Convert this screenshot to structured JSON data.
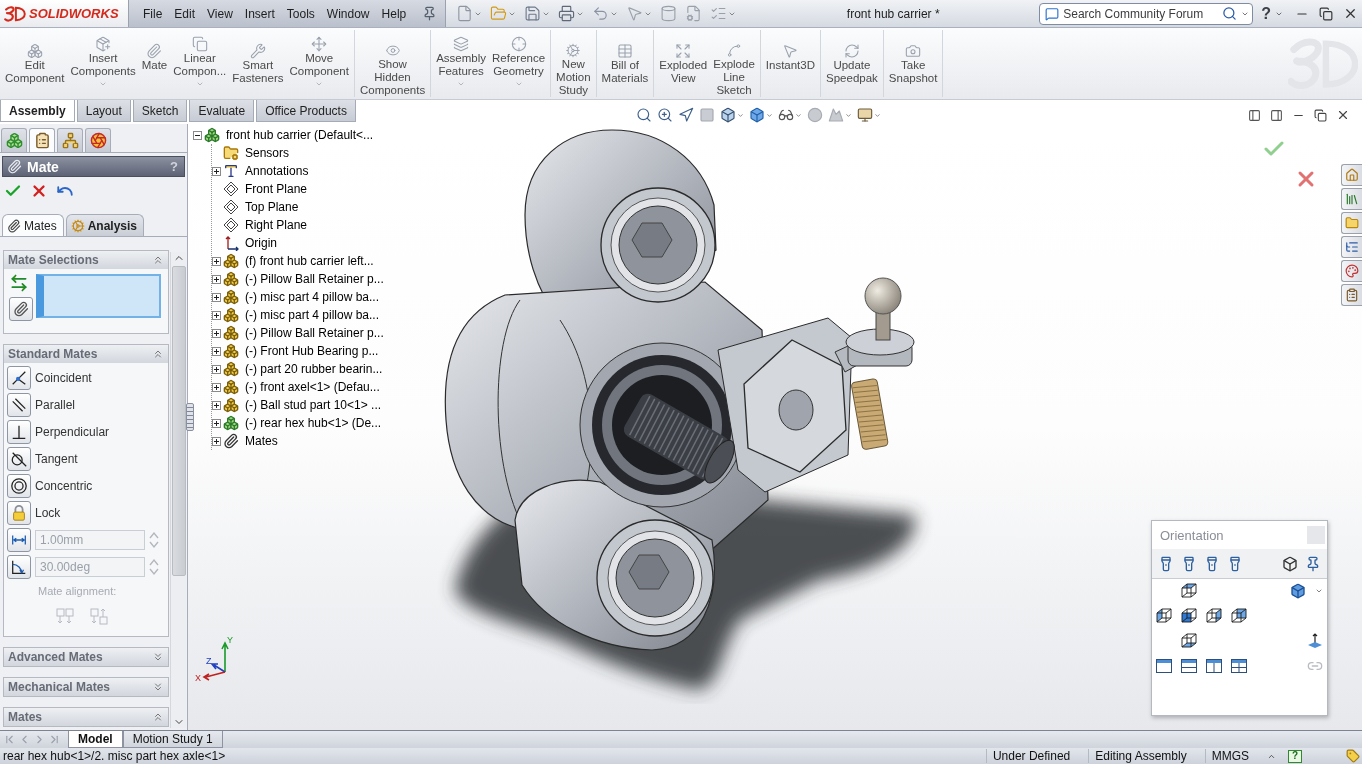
{
  "title_bar": {
    "logo": "SOLIDWORKS",
    "menu": [
      "File",
      "Edit",
      "View",
      "Insert",
      "Tools",
      "Window",
      "Help"
    ],
    "document_title": "front hub carrier *",
    "search": {
      "placeholder": "Search Community Forum"
    },
    "help": "?"
  },
  "command_manager": {
    "groups": [
      [
        {
          "label": "Edit\nComponent",
          "dropdown": false
        },
        {
          "label": "Insert\nComponents",
          "dropdown": true
        },
        {
          "label": "Mate",
          "dropdown": false
        },
        {
          "label": "Linear\nCompon...",
          "dropdown": true
        },
        {
          "label": "Smart\nFasteners",
          "dropdown": false
        },
        {
          "label": "Move\nComponent",
          "dropdown": true
        }
      ],
      [
        {
          "label": "Show\nHidden\nComponents",
          "dropdown": false
        }
      ],
      [
        {
          "label": "Assembly\nFeatures",
          "dropdown": true
        },
        {
          "label": "Reference\nGeometry",
          "dropdown": true
        }
      ],
      [
        {
          "label": "New\nMotion\nStudy",
          "dropdown": false
        }
      ],
      [
        {
          "label": "Bill of\nMaterials",
          "dropdown": false
        }
      ],
      [
        {
          "label": "Exploded\nView",
          "dropdown": false
        },
        {
          "label": "Explode\nLine\nSketch",
          "dropdown": false
        }
      ],
      [
        {
          "label": "Instant3D",
          "dropdown": false
        }
      ],
      [
        {
          "label": "Update\nSpeedpak",
          "dropdown": false
        }
      ],
      [
        {
          "label": "Take\nSnapshot",
          "dropdown": false
        }
      ]
    ],
    "tabs": [
      {
        "label": "Assembly",
        "selected": true
      },
      {
        "label": "Layout",
        "selected": false
      },
      {
        "label": "Sketch",
        "selected": false
      },
      {
        "label": "Evaluate",
        "selected": false
      },
      {
        "label": "Office Products",
        "selected": false
      }
    ]
  },
  "left_panel": {
    "tabs": [
      {
        "selected": false
      },
      {
        "selected": true
      },
      {
        "selected": false
      },
      {
        "selected": false
      }
    ],
    "title": "Mate",
    "help": "?",
    "subtabs": [
      {
        "label": "Mates",
        "selected": true
      },
      {
        "label": "Analysis",
        "selected": false
      }
    ],
    "sections": [
      {
        "title": "Mate Selections",
        "expanded": true,
        "kind": "selections"
      },
      {
        "title": "Standard Mates",
        "expanded": true,
        "kind": "standard",
        "mates": [
          {
            "kind": "toggle",
            "label": "Coincident"
          },
          {
            "kind": "toggle",
            "label": "Parallel"
          },
          {
            "kind": "toggle",
            "label": "Perpendicular"
          },
          {
            "kind": "toggle",
            "label": "Tangent"
          },
          {
            "kind": "toggle",
            "label": "Concentric"
          },
          {
            "kind": "toggle",
            "label": "Lock"
          },
          {
            "kind": "distance",
            "value": "1.00mm",
            "disabled": true
          },
          {
            "kind": "angle",
            "value": "30.00deg",
            "disabled": true
          }
        ],
        "alignment": {
          "label": "Mate alignment:",
          "disabled": true
        }
      },
      {
        "title": "Advanced Mates",
        "expanded": false
      },
      {
        "title": "Mechanical Mates",
        "expanded": false
      },
      {
        "title": "Mates",
        "expanded": true
      }
    ]
  },
  "feature_tree": {
    "root": {
      "label": "front hub carrier (Default<...",
      "kind": "assembly",
      "expanded": true,
      "children": [
        {
          "label": "Sensors",
          "kind": "sensors"
        },
        {
          "label": "Annotations",
          "kind": "annotations",
          "expanded": false
        },
        {
          "label": "Front Plane",
          "kind": "plane"
        },
        {
          "label": "Top Plane",
          "kind": "plane"
        },
        {
          "label": "Right Plane",
          "kind": "plane"
        },
        {
          "label": "Origin",
          "kind": "origin"
        },
        {
          "label": "(f) front hub carrier left...",
          "kind": "part",
          "expanded": false
        },
        {
          "label": "(-) Pillow Ball Retainer p...",
          "kind": "part",
          "expanded": false
        },
        {
          "label": "(-) misc part 4 pillow ba...",
          "kind": "part",
          "expanded": false
        },
        {
          "label": "(-) misc part 4 pillow ba...",
          "kind": "part",
          "expanded": false
        },
        {
          "label": "(-) Pillow Ball Retainer p...",
          "kind": "part",
          "expanded": false
        },
        {
          "label": "(-) Front Hub Bearing p...",
          "kind": "part",
          "expanded": false
        },
        {
          "label": "(-) part 20 rubber bearin...",
          "kind": "part",
          "expanded": false
        },
        {
          "label": "(-) front axel<1> (Defau...",
          "kind": "part",
          "expanded": false
        },
        {
          "label": "(-) Ball stud part 10<1> ...",
          "kind": "part",
          "expanded": false
        },
        {
          "label": "(-) rear hex hub<1> (De...",
          "kind": "assembly",
          "expanded": false
        },
        {
          "label": "Mates",
          "kind": "mates",
          "expanded": false
        }
      ]
    }
  },
  "orientation_dialog": {
    "title": "Orientation"
  },
  "triad": {
    "axes": [
      "Y",
      "Z",
      "X"
    ]
  },
  "model_tabs": [
    {
      "label": "Model",
      "selected": true
    },
    {
      "label": "Motion Study 1",
      "selected": false
    }
  ],
  "status_bar": {
    "selection": "rear hex hub<1>/2. misc part hex axle<1>",
    "fields": [
      "Under Defined",
      "Editing Assembly",
      "MMGS"
    ],
    "help": "?"
  }
}
